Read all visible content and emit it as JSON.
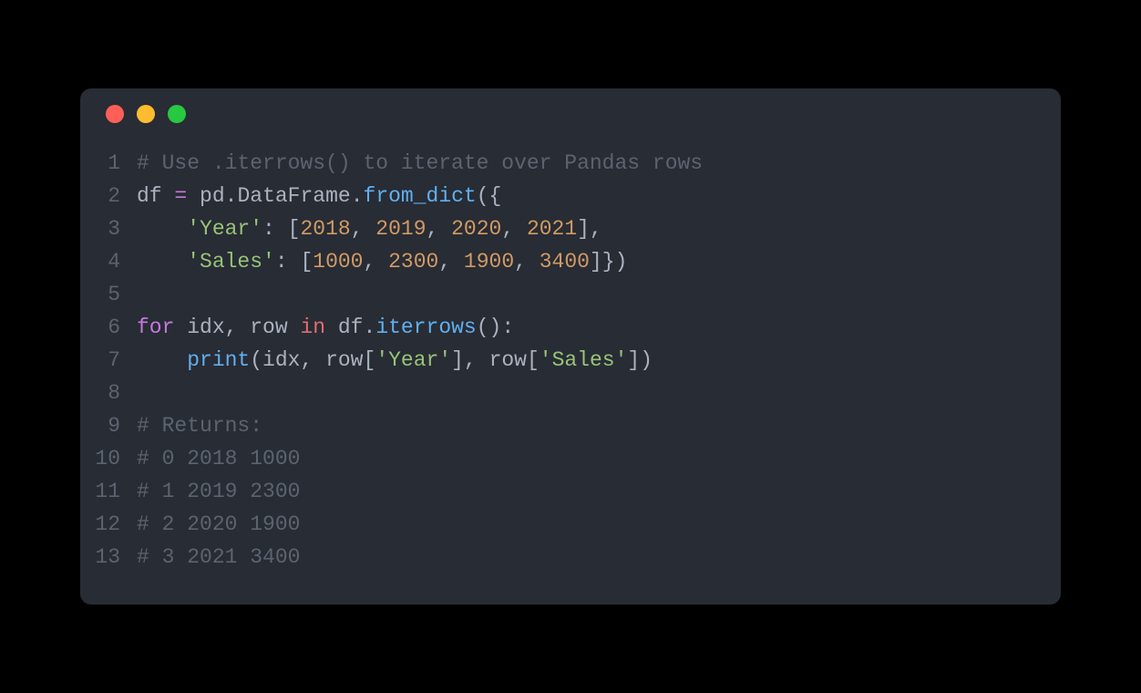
{
  "window": {
    "traffic_lights": {
      "close": "close",
      "minimize": "minimize",
      "zoom": "zoom"
    }
  },
  "code": {
    "lines": [
      {
        "n": "1",
        "tokens": [
          [
            "comment",
            "# Use .iterrows() to iterate over Pandas rows"
          ]
        ]
      },
      {
        "n": "2",
        "tokens": [
          [
            "ident",
            "df "
          ],
          [
            "op",
            "="
          ],
          [
            "ident",
            " pd"
          ],
          [
            "punct",
            "."
          ],
          [
            "ident",
            "DataFrame"
          ],
          [
            "punct",
            "."
          ],
          [
            "method",
            "from_dict"
          ],
          [
            "punct",
            "({"
          ]
        ]
      },
      {
        "n": "3",
        "tokens": [
          [
            "ident",
            "    "
          ],
          [
            "string",
            "'Year'"
          ],
          [
            "punct",
            ": ["
          ],
          [
            "number",
            "2018"
          ],
          [
            "punct",
            ", "
          ],
          [
            "number",
            "2019"
          ],
          [
            "punct",
            ", "
          ],
          [
            "number",
            "2020"
          ],
          [
            "punct",
            ", "
          ],
          [
            "number",
            "2021"
          ],
          [
            "punct",
            "],"
          ]
        ]
      },
      {
        "n": "4",
        "tokens": [
          [
            "ident",
            "    "
          ],
          [
            "string",
            "'Sales'"
          ],
          [
            "punct",
            ": ["
          ],
          [
            "number",
            "1000"
          ],
          [
            "punct",
            ", "
          ],
          [
            "number",
            "2300"
          ],
          [
            "punct",
            ", "
          ],
          [
            "number",
            "1900"
          ],
          [
            "punct",
            ", "
          ],
          [
            "number",
            "3400"
          ],
          [
            "punct",
            "]})"
          ]
        ]
      },
      {
        "n": "5",
        "tokens": [
          [
            "ident",
            ""
          ]
        ]
      },
      {
        "n": "6",
        "tokens": [
          [
            "keyword",
            "for"
          ],
          [
            "ident",
            " idx"
          ],
          [
            "punct",
            ", "
          ],
          [
            "ident",
            "row "
          ],
          [
            "keyword-red",
            "in"
          ],
          [
            "ident",
            " df"
          ],
          [
            "punct",
            "."
          ],
          [
            "method",
            "iterrows"
          ],
          [
            "punct",
            "():"
          ]
        ]
      },
      {
        "n": "7",
        "tokens": [
          [
            "ident",
            "    "
          ],
          [
            "method",
            "print"
          ],
          [
            "punct",
            "("
          ],
          [
            "ident",
            "idx"
          ],
          [
            "punct",
            ", "
          ],
          [
            "ident",
            "row"
          ],
          [
            "punct",
            "["
          ],
          [
            "string",
            "'Year'"
          ],
          [
            "punct",
            "], "
          ],
          [
            "ident",
            "row"
          ],
          [
            "punct",
            "["
          ],
          [
            "string",
            "'Sales'"
          ],
          [
            "punct",
            "])"
          ]
        ]
      },
      {
        "n": "8",
        "tokens": [
          [
            "ident",
            ""
          ]
        ]
      },
      {
        "n": "9",
        "tokens": [
          [
            "comment",
            "# Returns:"
          ]
        ]
      },
      {
        "n": "10",
        "tokens": [
          [
            "comment",
            "# 0 2018 1000"
          ]
        ]
      },
      {
        "n": "11",
        "tokens": [
          [
            "comment",
            "# 1 2019 2300"
          ]
        ]
      },
      {
        "n": "12",
        "tokens": [
          [
            "comment",
            "# 2 2020 1900"
          ]
        ]
      },
      {
        "n": "13",
        "tokens": [
          [
            "comment",
            "# 3 2021 3400"
          ]
        ]
      }
    ]
  }
}
